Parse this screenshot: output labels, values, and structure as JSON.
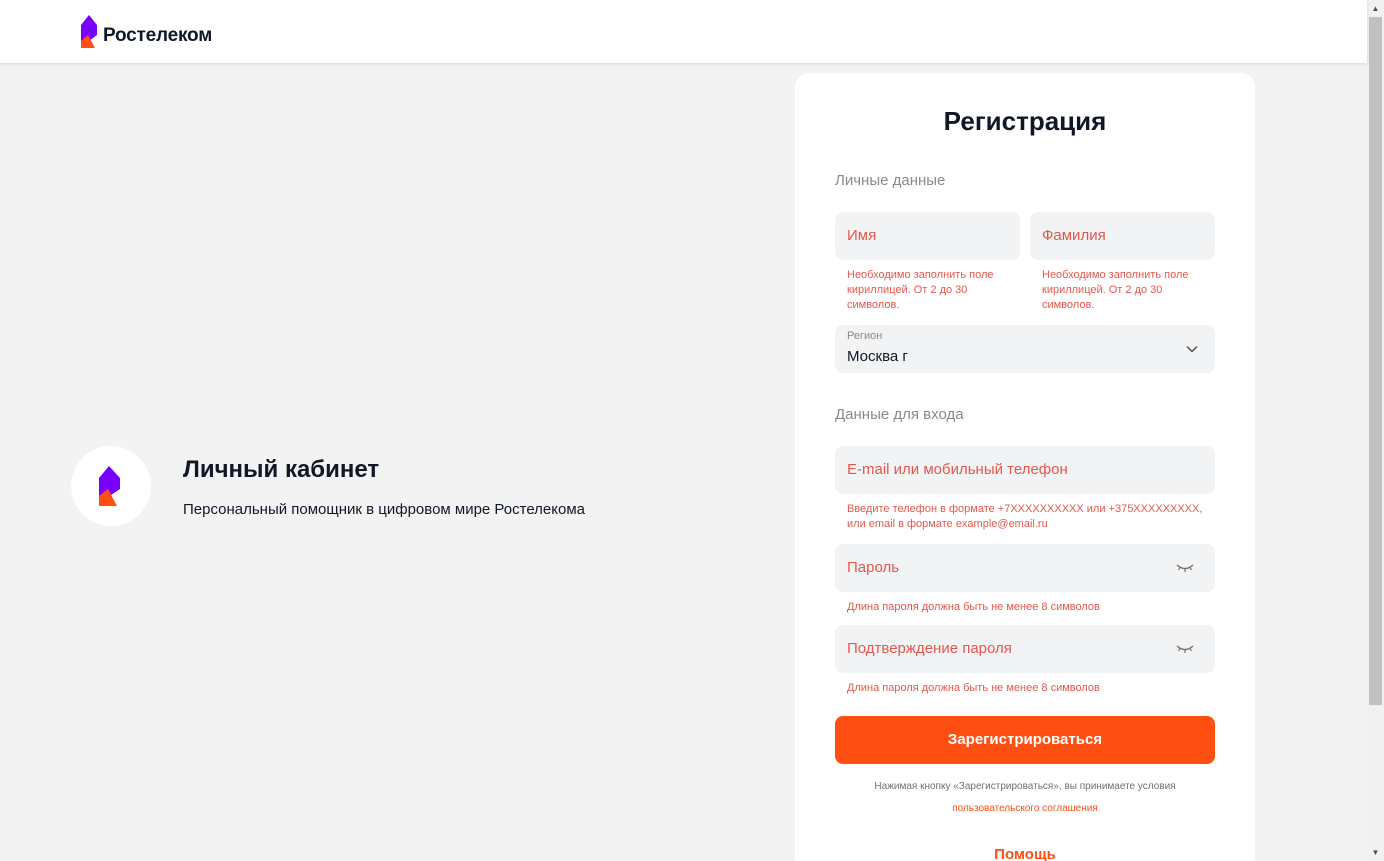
{
  "header": {
    "logo_text": "Ростелеком"
  },
  "promo": {
    "title": "Личный кабинет",
    "subtitle": "Персональный помощник в цифровом мире Ростелекома"
  },
  "form": {
    "title": "Регистрация",
    "personal_label": "Личные данные",
    "first_name_placeholder": "Имя",
    "last_name_placeholder": "Фамилия",
    "first_name_error": "Необходимо заполнить поле кириллицей. От 2 до 30 символов.",
    "last_name_error": "Необходимо заполнить поле кириллицей. От 2 до 30 символов.",
    "region_label": "Регион",
    "region_value": "Москва г",
    "login_label": "Данные для входа",
    "contact_placeholder": "E-mail или мобильный телефон",
    "contact_error_line1": "Введите телефон в формате +7XXXXXXXXXX или +375XXXXXXXXX,",
    "contact_error_line2": "или email в формате example@email.ru",
    "password_placeholder": "Пароль",
    "password_error": "Длина пароля должна быть не менее 8 символов",
    "confirm_placeholder": "Подтверждение пароля",
    "confirm_error": "Длина пароля должна быть не менее 8 символов",
    "submit_label": "Зарегистрироваться",
    "terms_text": "Нажимая кнопку «Зарегистрироваться», вы принимаете условия",
    "terms_link": "пользовательского соглашения",
    "help_label": "Помощь"
  },
  "colors": {
    "brand_purple": "#7700ff",
    "brand_orange": "#ff4f12",
    "error_red": "#e6574d"
  },
  "icons": [
    "rostelecom-logo-icon",
    "eye-closed-icon",
    "chevron-down-icon"
  ]
}
